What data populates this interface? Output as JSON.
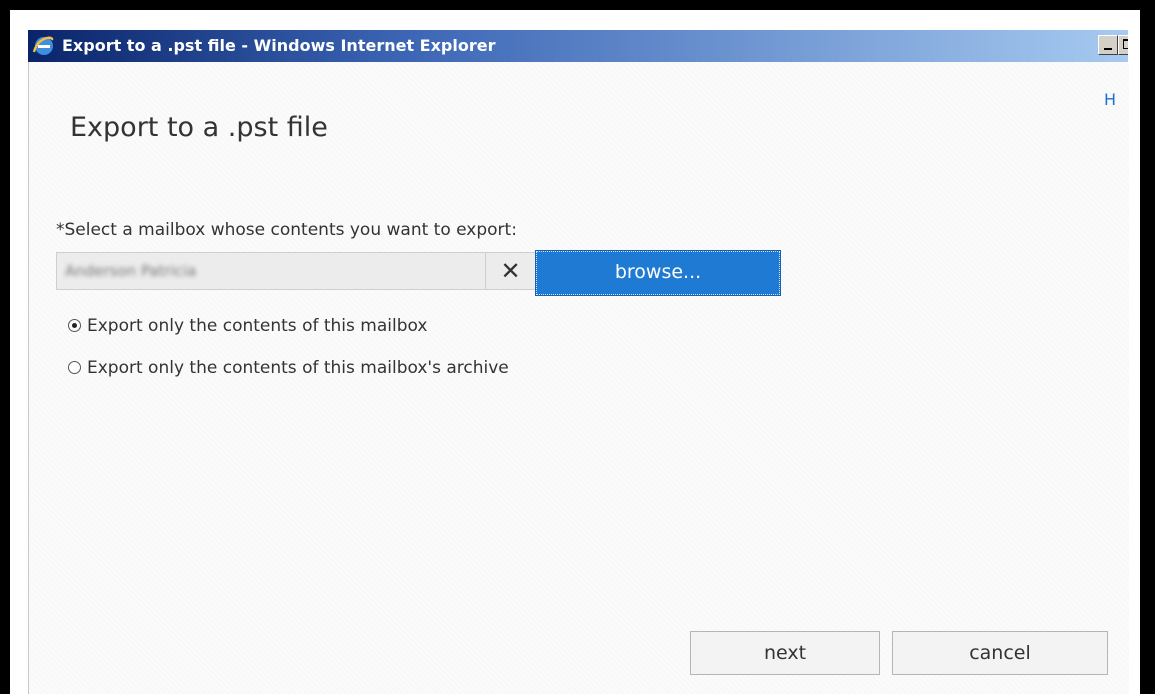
{
  "window": {
    "title": "Export to a .pst file - Windows Internet Explorer"
  },
  "help_link": "H",
  "page_title": "Export to a .pst file",
  "prompt": "*Select a mailbox whose contents you want to export:",
  "mailbox_field": {
    "value": "Anderson Patricia",
    "clear_glyph": "✕"
  },
  "browse_label": "browse...",
  "options": [
    {
      "label": "Export only the contents of this mailbox",
      "selected": true
    },
    {
      "label": "Export only the contents of this mailbox's archive",
      "selected": false
    }
  ],
  "buttons": {
    "next": "next",
    "cancel": "cancel"
  },
  "colors": {
    "accent": "#1f7ad4",
    "link": "#1e6fd0"
  },
  "icons": {
    "app": "internet-explorer-icon",
    "clear": "clear-icon"
  }
}
